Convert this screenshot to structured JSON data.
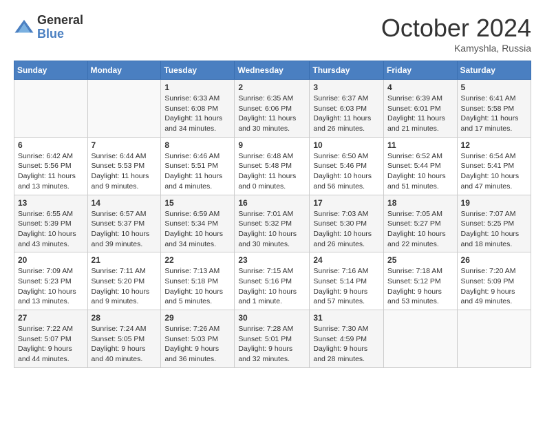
{
  "header": {
    "logo_general": "General",
    "logo_blue": "Blue",
    "month_title": "October 2024",
    "location": "Kamyshla, Russia"
  },
  "weekdays": [
    "Sunday",
    "Monday",
    "Tuesday",
    "Wednesday",
    "Thursday",
    "Friday",
    "Saturday"
  ],
  "weeks": [
    [
      {
        "day": "",
        "info": ""
      },
      {
        "day": "",
        "info": ""
      },
      {
        "day": "1",
        "info": "Sunrise: 6:33 AM\nSunset: 6:08 PM\nDaylight: 11 hours and 34 minutes."
      },
      {
        "day": "2",
        "info": "Sunrise: 6:35 AM\nSunset: 6:06 PM\nDaylight: 11 hours and 30 minutes."
      },
      {
        "day": "3",
        "info": "Sunrise: 6:37 AM\nSunset: 6:03 PM\nDaylight: 11 hours and 26 minutes."
      },
      {
        "day": "4",
        "info": "Sunrise: 6:39 AM\nSunset: 6:01 PM\nDaylight: 11 hours and 21 minutes."
      },
      {
        "day": "5",
        "info": "Sunrise: 6:41 AM\nSunset: 5:58 PM\nDaylight: 11 hours and 17 minutes."
      }
    ],
    [
      {
        "day": "6",
        "info": "Sunrise: 6:42 AM\nSunset: 5:56 PM\nDaylight: 11 hours and 13 minutes."
      },
      {
        "day": "7",
        "info": "Sunrise: 6:44 AM\nSunset: 5:53 PM\nDaylight: 11 hours and 9 minutes."
      },
      {
        "day": "8",
        "info": "Sunrise: 6:46 AM\nSunset: 5:51 PM\nDaylight: 11 hours and 4 minutes."
      },
      {
        "day": "9",
        "info": "Sunrise: 6:48 AM\nSunset: 5:48 PM\nDaylight: 11 hours and 0 minutes."
      },
      {
        "day": "10",
        "info": "Sunrise: 6:50 AM\nSunset: 5:46 PM\nDaylight: 10 hours and 56 minutes."
      },
      {
        "day": "11",
        "info": "Sunrise: 6:52 AM\nSunset: 5:44 PM\nDaylight: 10 hours and 51 minutes."
      },
      {
        "day": "12",
        "info": "Sunrise: 6:54 AM\nSunset: 5:41 PM\nDaylight: 10 hours and 47 minutes."
      }
    ],
    [
      {
        "day": "13",
        "info": "Sunrise: 6:55 AM\nSunset: 5:39 PM\nDaylight: 10 hours and 43 minutes."
      },
      {
        "day": "14",
        "info": "Sunrise: 6:57 AM\nSunset: 5:37 PM\nDaylight: 10 hours and 39 minutes."
      },
      {
        "day": "15",
        "info": "Sunrise: 6:59 AM\nSunset: 5:34 PM\nDaylight: 10 hours and 34 minutes."
      },
      {
        "day": "16",
        "info": "Sunrise: 7:01 AM\nSunset: 5:32 PM\nDaylight: 10 hours and 30 minutes."
      },
      {
        "day": "17",
        "info": "Sunrise: 7:03 AM\nSunset: 5:30 PM\nDaylight: 10 hours and 26 minutes."
      },
      {
        "day": "18",
        "info": "Sunrise: 7:05 AM\nSunset: 5:27 PM\nDaylight: 10 hours and 22 minutes."
      },
      {
        "day": "19",
        "info": "Sunrise: 7:07 AM\nSunset: 5:25 PM\nDaylight: 10 hours and 18 minutes."
      }
    ],
    [
      {
        "day": "20",
        "info": "Sunrise: 7:09 AM\nSunset: 5:23 PM\nDaylight: 10 hours and 13 minutes."
      },
      {
        "day": "21",
        "info": "Sunrise: 7:11 AM\nSunset: 5:20 PM\nDaylight: 10 hours and 9 minutes."
      },
      {
        "day": "22",
        "info": "Sunrise: 7:13 AM\nSunset: 5:18 PM\nDaylight: 10 hours and 5 minutes."
      },
      {
        "day": "23",
        "info": "Sunrise: 7:15 AM\nSunset: 5:16 PM\nDaylight: 10 hours and 1 minute."
      },
      {
        "day": "24",
        "info": "Sunrise: 7:16 AM\nSunset: 5:14 PM\nDaylight: 9 hours and 57 minutes."
      },
      {
        "day": "25",
        "info": "Sunrise: 7:18 AM\nSunset: 5:12 PM\nDaylight: 9 hours and 53 minutes."
      },
      {
        "day": "26",
        "info": "Sunrise: 7:20 AM\nSunset: 5:09 PM\nDaylight: 9 hours and 49 minutes."
      }
    ],
    [
      {
        "day": "27",
        "info": "Sunrise: 7:22 AM\nSunset: 5:07 PM\nDaylight: 9 hours and 44 minutes."
      },
      {
        "day": "28",
        "info": "Sunrise: 7:24 AM\nSunset: 5:05 PM\nDaylight: 9 hours and 40 minutes."
      },
      {
        "day": "29",
        "info": "Sunrise: 7:26 AM\nSunset: 5:03 PM\nDaylight: 9 hours and 36 minutes."
      },
      {
        "day": "30",
        "info": "Sunrise: 7:28 AM\nSunset: 5:01 PM\nDaylight: 9 hours and 32 minutes."
      },
      {
        "day": "31",
        "info": "Sunrise: 7:30 AM\nSunset: 4:59 PM\nDaylight: 9 hours and 28 minutes."
      },
      {
        "day": "",
        "info": ""
      },
      {
        "day": "",
        "info": ""
      }
    ]
  ]
}
